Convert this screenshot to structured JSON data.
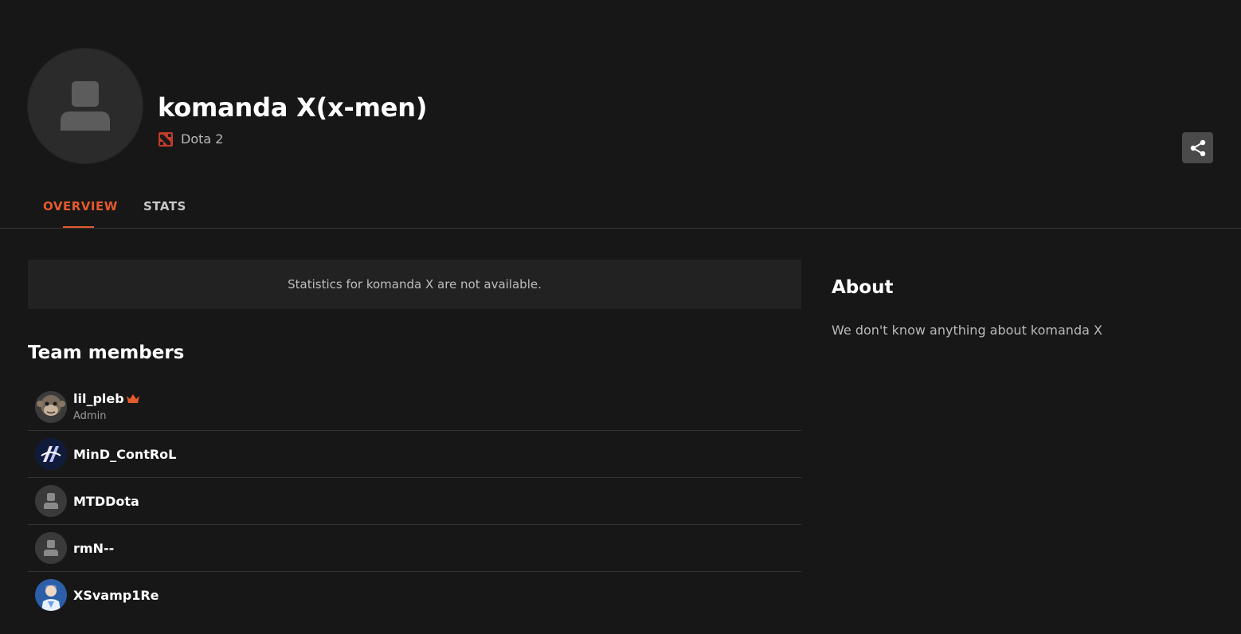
{
  "team": {
    "name": "komanda X(x-men)",
    "game": "Dota 2"
  },
  "colors": {
    "accent": "#e45a2d",
    "background": "#171717",
    "panel": "#222222"
  },
  "icons": {
    "team_avatar": "user-placeholder-icon",
    "game": "dota2-icon",
    "share": "share-icon",
    "admin": "crown-icon"
  },
  "tabs": [
    {
      "label": "OVERVIEW",
      "active": true
    },
    {
      "label": "STATS",
      "active": false
    }
  ],
  "stats_notice": "Statistics for komanda X are not available.",
  "members_section": {
    "title": "Team members",
    "members": [
      {
        "name": "lil_pleb",
        "role": "Admin",
        "avatar": "monkey-avatar"
      },
      {
        "name": "MinD_ContRoL",
        "role": "",
        "avatar": "logo-avatar"
      },
      {
        "name": "MTDDota",
        "role": "",
        "avatar": "user-placeholder-icon"
      },
      {
        "name": "rmN--",
        "role": "",
        "avatar": "user-placeholder-icon"
      },
      {
        "name": "XSvamp1Re",
        "role": "",
        "avatar": "character-avatar"
      }
    ]
  },
  "about": {
    "title": "About",
    "text": "We don't know anything about komanda X"
  }
}
